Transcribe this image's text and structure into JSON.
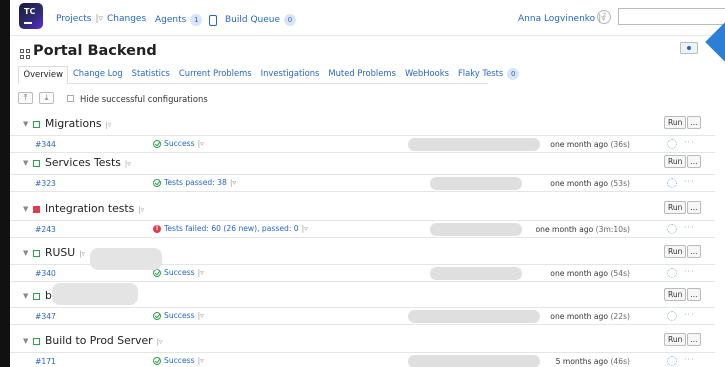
{
  "topbar": {
    "projects": "Projects",
    "changes": "Changes",
    "agents": "Agents",
    "agents_count": "1",
    "build_queue": "Build Queue",
    "build_queue_count": "0",
    "user": "Anna Logvinenko",
    "help": "?",
    "search_value": "",
    "logo_text": "TC"
  },
  "page": {
    "title": "Portal Backend"
  },
  "tabs": [
    {
      "label": "Overview"
    },
    {
      "label": "Change Log"
    },
    {
      "label": "Statistics"
    },
    {
      "label": "Current Problems"
    },
    {
      "label": "Investigations"
    },
    {
      "label": "Muted Problems"
    },
    {
      "label": "WebHooks"
    },
    {
      "label": "Flaky Tests"
    }
  ],
  "flaky_count": "0",
  "toolbar": {
    "hide_label": "Hide successful configurations"
  },
  "run": {
    "label": "Run",
    "more": "..."
  },
  "configs": [
    {
      "name": "Migrations",
      "state": "ok",
      "build": "#344",
      "status": "Success",
      "when": "one month ago",
      "duration": "(36s)"
    },
    {
      "name": "Services Tests",
      "state": "ok",
      "build": "#323",
      "status": "Tests passed: 38",
      "when": "one month ago",
      "duration": "(53s)"
    },
    {
      "name": "Integration tests",
      "state": "fail",
      "build": "#243",
      "status": "Tests failed: 60 (26 new), passed: 0",
      "when": "one month ago",
      "duration": "(3m:10s)"
    },
    {
      "name": "RUSU",
      "state": "ok",
      "build": "#340",
      "status": "Success",
      "when": "one month ago",
      "duration": "(54s)"
    },
    {
      "name": "build",
      "state": "ok",
      "build": "#347",
      "status": "Success",
      "when": "one month ago",
      "duration": "(22s)"
    },
    {
      "name": "Build to Prod Server",
      "state": "ok",
      "build": "#171",
      "status": "Success",
      "when": "5 months ago",
      "duration": "(46s)"
    }
  ],
  "colors": {
    "link": "#2567c7",
    "success": "#2aa34a",
    "failure": "#e03b4e",
    "accent": "#2b7fd6"
  }
}
